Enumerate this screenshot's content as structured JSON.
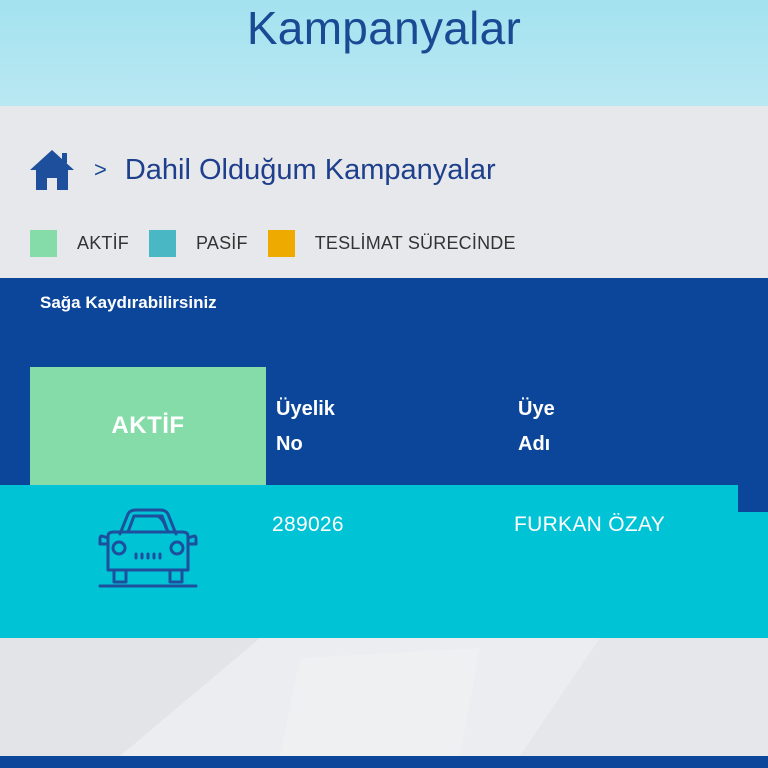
{
  "header": {
    "title": "Kampanyalar"
  },
  "breadcrumb": {
    "separator": ">",
    "current": "Dahil Olduğum Kampanyalar"
  },
  "legend": [
    {
      "label": "AKTİF",
      "color": "#86dca8"
    },
    {
      "label": "PASİF",
      "color": "#4ab7c4"
    },
    {
      "label": "TESLİMAT SÜRECİNDE",
      "color": "#efaa00"
    }
  ],
  "table": {
    "scroll_hint": "Sağa Kaydırabilirsiniz",
    "status_header": "AKTİF",
    "columns": {
      "membership_no": [
        "Üyelik",
        "No"
      ],
      "member_name": [
        "Üye",
        "Adı"
      ]
    },
    "rows": [
      {
        "icon": "car-icon",
        "membership_no": "289026",
        "member_name": "FURKAN ÖZAY"
      }
    ]
  },
  "colors": {
    "brand_blue": "#0b469b",
    "header_bg": "#a3e2f0",
    "row_bg": "#00c3d6",
    "active_green": "#86dca8"
  }
}
